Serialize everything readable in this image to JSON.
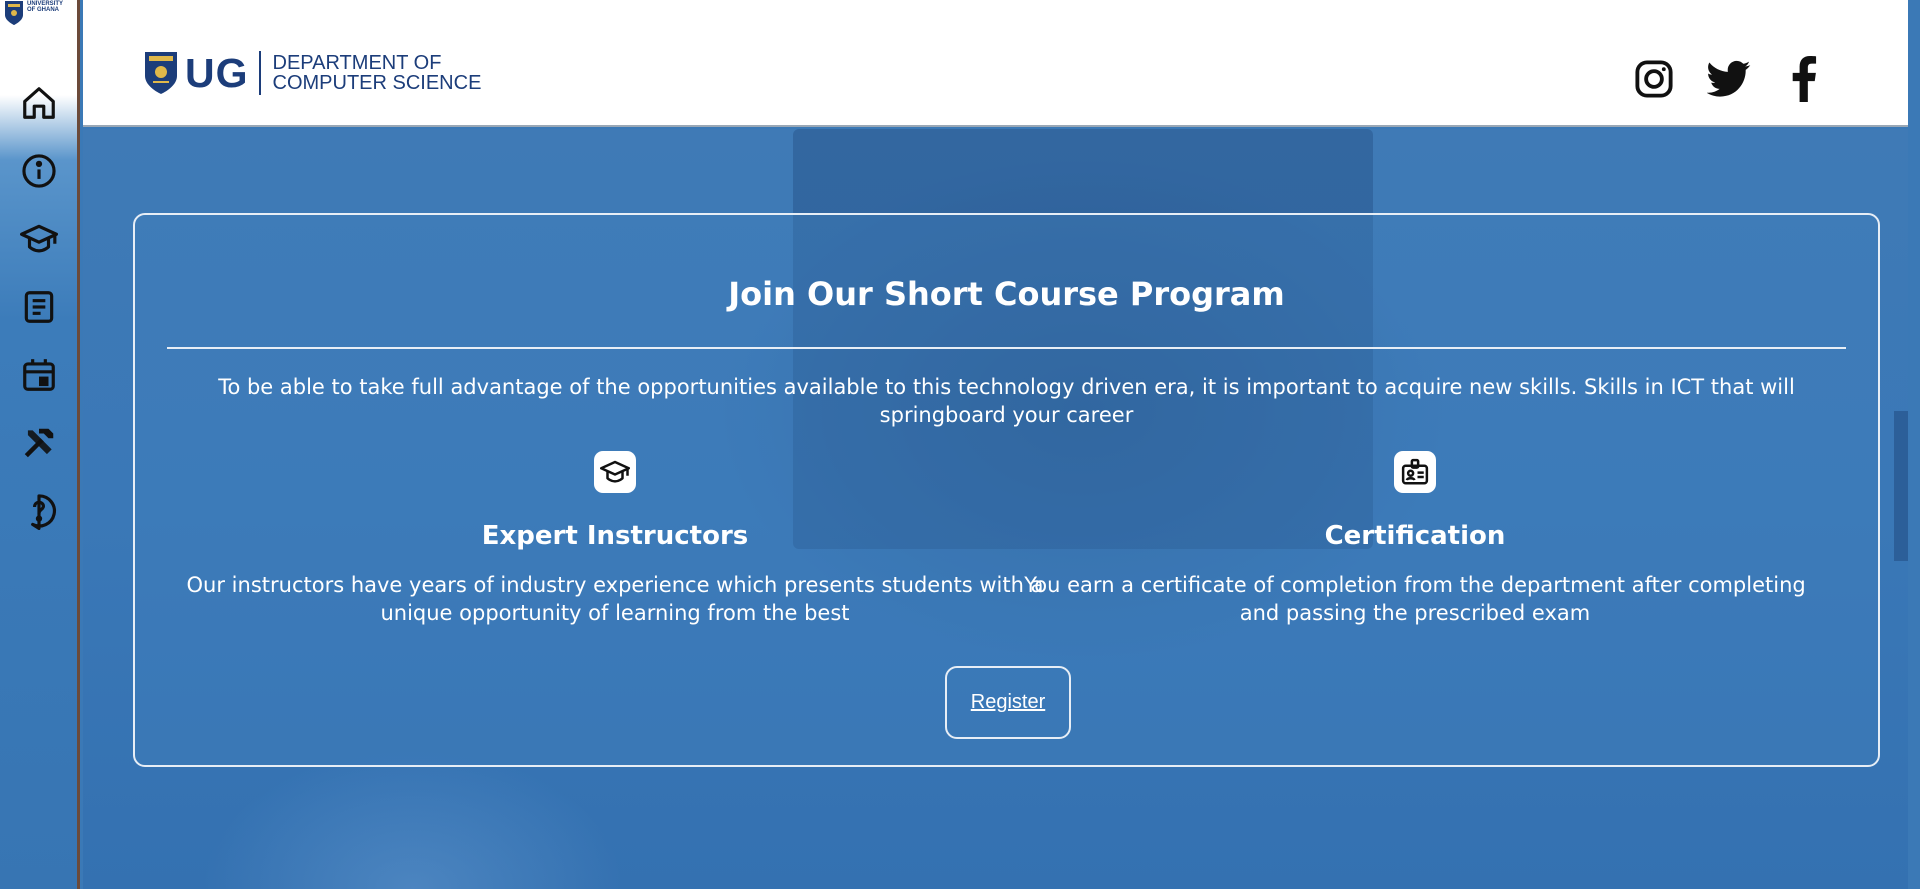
{
  "sidebar": {
    "logo_text_line1": "UNIVERSITY",
    "logo_text_line2": "OF GHANA",
    "items": [
      {
        "icon": "home-icon"
      },
      {
        "icon": "info-icon"
      },
      {
        "icon": "graduation-cap-icon"
      },
      {
        "icon": "document-icon"
      },
      {
        "icon": "calendar-icon"
      },
      {
        "icon": "tools-icon"
      },
      {
        "icon": "help-icon"
      }
    ]
  },
  "header": {
    "brand_short": "UG",
    "dept_line1": "DEPARTMENT OF",
    "dept_line2": "COMPUTER SCIENCE",
    "social": [
      "instagram-icon",
      "twitter-icon",
      "facebook-icon"
    ]
  },
  "card": {
    "title": "Join Our Short Course Program",
    "intro": "To be able to take full advantage of the opportunities available to this technology driven era, it is important to acquire new skills. Skills in ICT that will springboard your career",
    "features": [
      {
        "icon": "graduation-cap-icon",
        "title": "Expert Instructors",
        "desc": "Our instructors have years of industry experience which presents students with a unique opportunity of learning from the best"
      },
      {
        "icon": "certificate-badge-icon",
        "title": "Certification",
        "desc": "You earn a certificate of completion from the department after completing and passing the prescribed exam"
      }
    ],
    "register_label": "Register"
  },
  "colors": {
    "brand": "#1c3d7a",
    "hero_blue": "#3b79b6",
    "card_border": "#e7eef6"
  }
}
